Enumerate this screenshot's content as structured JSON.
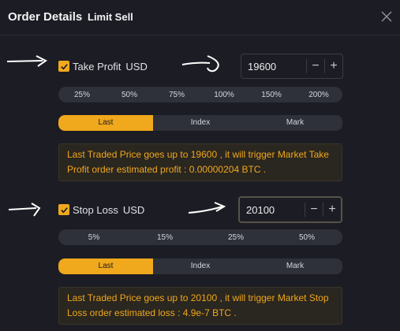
{
  "header": {
    "title": "Order Details",
    "subtitle": "Limit Sell"
  },
  "take_profit": {
    "label": "Take Profit",
    "unit": "USD",
    "checked": true,
    "value": "19600",
    "percentages": [
      "25%",
      "50%",
      "75%",
      "100%",
      "150%",
      "200%"
    ],
    "price_types": [
      "Last",
      "Index",
      "Mark"
    ],
    "selected_price_type": "Last",
    "info": "Last Traded Price goes up to 19600 , it will trigger Market Take Profit order estimated profit : 0.00000204 BTC ."
  },
  "stop_loss": {
    "label": "Stop Loss",
    "unit": "USD",
    "checked": true,
    "value": "20100",
    "percentages": [
      "5%",
      "15%",
      "25%",
      "50%"
    ],
    "price_types": [
      "Last",
      "Index",
      "Mark"
    ],
    "selected_price_type": "Last",
    "info": "Last Traded Price goes up to 20100 , it will trigger Market Stop Loss order estimated loss : 4.9e-7 BTC ."
  },
  "stepper": {
    "minus": "−",
    "plus": "+"
  },
  "colors": {
    "accent": "#f0a81c",
    "background": "#1c1d24",
    "pill": "#2e303a"
  }
}
